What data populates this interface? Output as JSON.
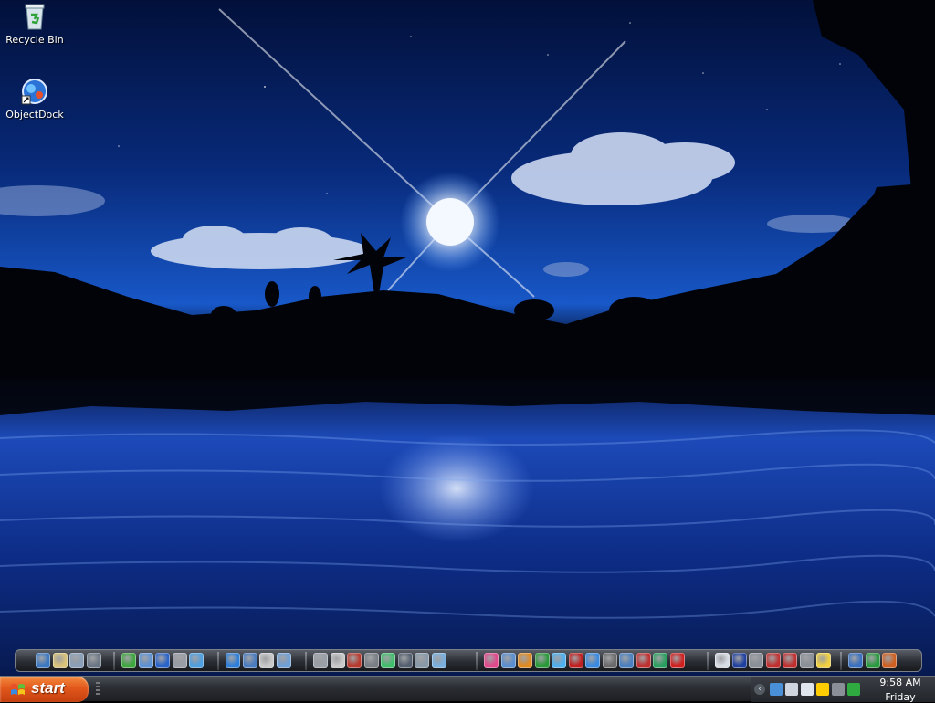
{
  "desktop": {
    "icons": [
      {
        "label": "Recycle Bin",
        "icon": "recycle-bin-icon"
      },
      {
        "label": "ObjectDock",
        "icon": "objectdock-icon"
      }
    ]
  },
  "dock": {
    "groups": [
      {
        "icons": [
          "network-icon",
          "folder-icon",
          "files-icon",
          "trash-icon"
        ],
        "colors": [
          "#3b78c2",
          "#d9c27a",
          "#8aa0b8",
          "#6b7785"
        ]
      },
      {
        "icons": [
          "game-icon",
          "settings-icon",
          "calendar-icon",
          "paint-icon",
          "network-share-icon"
        ],
        "colors": [
          "#3fa640",
          "#5d93d6",
          "#2a63c9",
          "#9a9ea6",
          "#4fa0e0"
        ]
      },
      {
        "icons": [
          "globe-icon",
          "globe2-icon",
          "people-icon",
          "search-icon"
        ],
        "colors": [
          "#2f7fd8",
          "#4a7cc0",
          "#c9c9c9",
          "#6fa0d8"
        ]
      },
      {
        "icons": [
          "gear-icon",
          "media-icon",
          "app-icon",
          "tool-icon",
          "green-app-icon",
          "gallery-icon",
          "chart-icon",
          "dv-icon"
        ],
        "colors": [
          "#9aa0a8",
          "#c9c9c9",
          "#b83a2e",
          "#7a7f86",
          "#3fbf6a",
          "#556070",
          "#8899aa",
          "#7ab0e0"
        ]
      },
      {
        "icons": [
          "color-icon",
          "steam-icon",
          "firefox-icon",
          "tiles-icon",
          "itunes-icon",
          "app-red-icon",
          "ie-icon",
          "nvidia-icon",
          "disk-icon",
          "close-app-icon",
          "music-icon",
          "opera-icon"
        ],
        "colors": [
          "#e04a8c",
          "#5a8fd0",
          "#e08a1f",
          "#2a9a3a",
          "#4fb0f0",
          "#c02020",
          "#3a8ae0",
          "#6a6a6a",
          "#4a80c0",
          "#c03030",
          "#2aa060",
          "#d02020"
        ]
      },
      {
        "icons": [
          "document-icon",
          "numbers-icon",
          "steam2-icon",
          "y-icon",
          "y2-icon",
          "remote-icon",
          "note-icon"
        ],
        "colors": [
          "#d8dde4",
          "#2040a0",
          "#8a8f98",
          "#c03030",
          "#c03030",
          "#8a8f98",
          "#f0d040"
        ]
      },
      {
        "icons": [
          "calendar2-icon",
          "excel-icon",
          "powerpoint-icon"
        ],
        "colors": [
          "#3a70c0",
          "#2a9a40",
          "#d06020"
        ]
      }
    ]
  },
  "taskbar": {
    "start_label": "start",
    "tray_toggle": "‹",
    "tray_icons": [
      "network-monitor-icon",
      "volume-icon",
      "display-icon",
      "color-tiles-icon",
      "disconnected-icon",
      "tree-icon"
    ],
    "tray_colors": [
      "#4a90d8",
      "#cfd6e0",
      "#dfe6ee",
      "#ffcc00",
      "#8a8f98",
      "#2faa40"
    ],
    "clock_time": "9:58 AM",
    "clock_day": "Friday"
  }
}
